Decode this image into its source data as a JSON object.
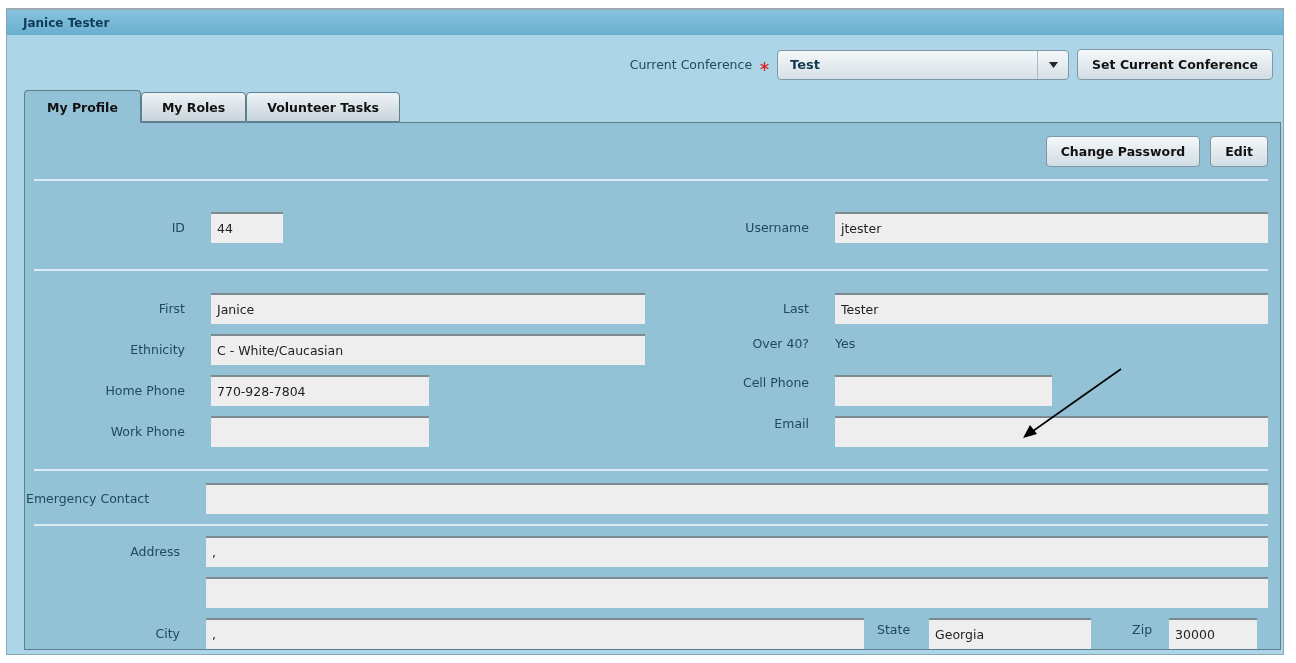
{
  "window": {
    "title": "Janice Tester"
  },
  "conference": {
    "label": "Current Conference",
    "required": true,
    "value": "Test",
    "button": "Set Current Conference"
  },
  "tabs": [
    {
      "label": "My Profile",
      "selected": true
    },
    {
      "label": "My Roles",
      "selected": false
    },
    {
      "label": "Volunteer Tasks",
      "selected": false
    }
  ],
  "actions": [
    "Change Password",
    "Edit"
  ],
  "id": {
    "label": "ID",
    "value": "44"
  },
  "username": {
    "label": "Username",
    "value": "jtester"
  },
  "first": {
    "label": "First",
    "value": "Janice"
  },
  "last": {
    "label": "Last",
    "value": "Tester"
  },
  "ethnicity": {
    "label": "Ethnicity",
    "value": "C - White/Caucasian"
  },
  "over_40": {
    "label": "Over 40?",
    "value": "Yes"
  },
  "home_phone": {
    "label": "Home Phone",
    "value": "770-928-7804"
  },
  "cell_phone": {
    "label": "Cell Phone"
  },
  "work_phone": {
    "label": "Work Phone"
  },
  "email": {
    "label": "Email"
  },
  "emergency_contact": {
    "label": "Emergency Contact"
  },
  "address": {
    "label": "Address",
    "line_1": ","
  },
  "city": {
    "label": "City",
    "value": ","
  },
  "state": {
    "label": "State",
    "value": "Georgia"
  },
  "zip": {
    "label": "Zip",
    "value": "30000"
  }
}
